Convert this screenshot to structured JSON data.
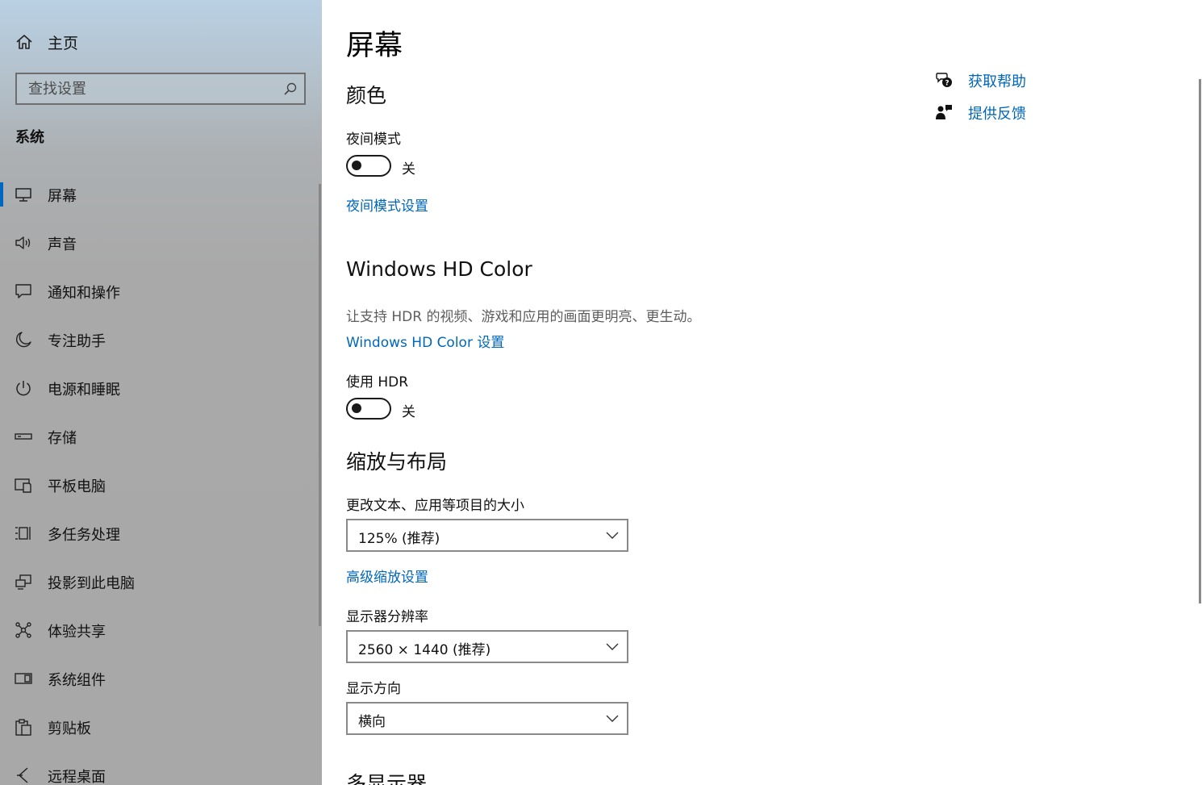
{
  "sidebar": {
    "home_label": "主页",
    "search_placeholder": "查找设置",
    "section_title": "系统",
    "items": [
      {
        "label": "屏幕",
        "icon": "monitor-icon",
        "selected": true
      },
      {
        "label": "声音",
        "icon": "speaker-icon"
      },
      {
        "label": "通知和操作",
        "icon": "message-icon"
      },
      {
        "label": "专注助手",
        "icon": "moon-icon"
      },
      {
        "label": "电源和睡眠",
        "icon": "power-icon"
      },
      {
        "label": "存储",
        "icon": "storage-icon"
      },
      {
        "label": "平板电脑",
        "icon": "tablet-icon"
      },
      {
        "label": "多任务处理",
        "icon": "multitask-icon"
      },
      {
        "label": "投影到此电脑",
        "icon": "project-icon"
      },
      {
        "label": "体验共享",
        "icon": "share-icon"
      },
      {
        "label": "系统组件",
        "icon": "components-icon"
      },
      {
        "label": "剪贴板",
        "icon": "clipboard-icon"
      },
      {
        "label": "远程桌面",
        "icon": "remote-desktop-icon"
      }
    ]
  },
  "main": {
    "title": "屏幕",
    "color": {
      "heading": "颜色",
      "night_mode_label": "夜间模式",
      "night_mode_state": "关",
      "night_mode_link": "夜间模式设置"
    },
    "hdr": {
      "heading": "Windows HD Color",
      "description": "让支持 HDR 的视频、游戏和应用的画面更明亮、更生动。",
      "settings_link": "Windows HD Color 设置",
      "use_hdr_label": "使用 HDR",
      "use_hdr_state": "关"
    },
    "scale": {
      "heading": "缩放与布局",
      "text_size_label": "更改文本、应用等项目的大小",
      "text_size_value": "125% (推荐)",
      "advanced_link": "高级缩放设置",
      "resolution_label": "显示器分辨率",
      "resolution_value": "2560 × 1440 (推荐)",
      "orientation_label": "显示方向",
      "orientation_value": "横向"
    },
    "multi_display_heading": "多显示器"
  },
  "help": {
    "get_help": "获取帮助",
    "feedback": "提供反馈"
  },
  "colors": {
    "accent": "#0067c0",
    "link": "#0067b8"
  }
}
